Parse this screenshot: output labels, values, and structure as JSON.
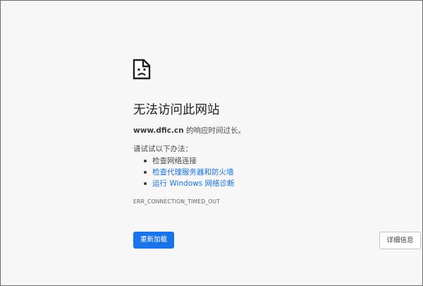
{
  "error": {
    "icon": "sad-document-icon",
    "title": "无法访问此网站",
    "host": "www.dfic.cn",
    "summary_suffix": " 的响应时间过长。",
    "suggestions_heading": "请试试以下办法：",
    "suggestions": [
      {
        "label": "检查网络连接",
        "is_link": false
      },
      {
        "label": "检查代理服务器和防火墙",
        "is_link": true
      },
      {
        "label": "运行 Windows 网络诊断",
        "is_link": true
      }
    ],
    "code": "ERR_CONNECTION_TIMED_OUT"
  },
  "buttons": {
    "reload_label": "重新加载",
    "details_label": "详细信息"
  },
  "colors": {
    "page_background": "#f7f7f7",
    "link": "#1a73e8",
    "primary_button": "#1a73e8",
    "text": "#202124"
  }
}
